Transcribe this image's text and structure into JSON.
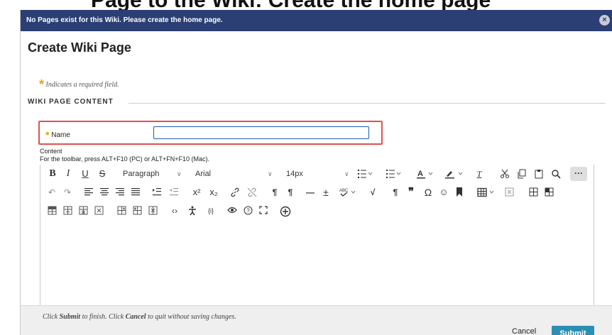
{
  "caption": "Page to the Wiki: Create the home page",
  "banner": {
    "message": "No Pages exist for this Wiki. Please create the home page.",
    "close": "×"
  },
  "dialog": {
    "title": "Create Wiki Page"
  },
  "required_note": {
    "star": "*",
    "text": "Indicates a required field."
  },
  "section": {
    "heading": "WIKI PAGE CONTENT"
  },
  "name_field": {
    "star": "*",
    "label": "Name",
    "value": "",
    "placeholder": ""
  },
  "content": {
    "label": "Content",
    "hint": "For the toolbar, press ALT+F10 (PC) or ALT+FN+F10 (Mac)."
  },
  "toolbar": {
    "paragraph": "Paragraph",
    "font": "Arial",
    "size": "14px",
    "more": "···",
    "chevron": "∨"
  },
  "footer": {
    "hint_prefix": "Click ",
    "submit_word": "Submit",
    "hint_mid": " to finish. Click ",
    "cancel_word": "Cancel",
    "hint_suffix": " to quit without saving changes.",
    "cancel_label": "Cancel",
    "submit_label": "Submit"
  },
  "colors": {
    "banner": "#2b3f74",
    "required_star": "#f0a000",
    "highlight": "#e15050",
    "submit": "#2b8fb3"
  }
}
